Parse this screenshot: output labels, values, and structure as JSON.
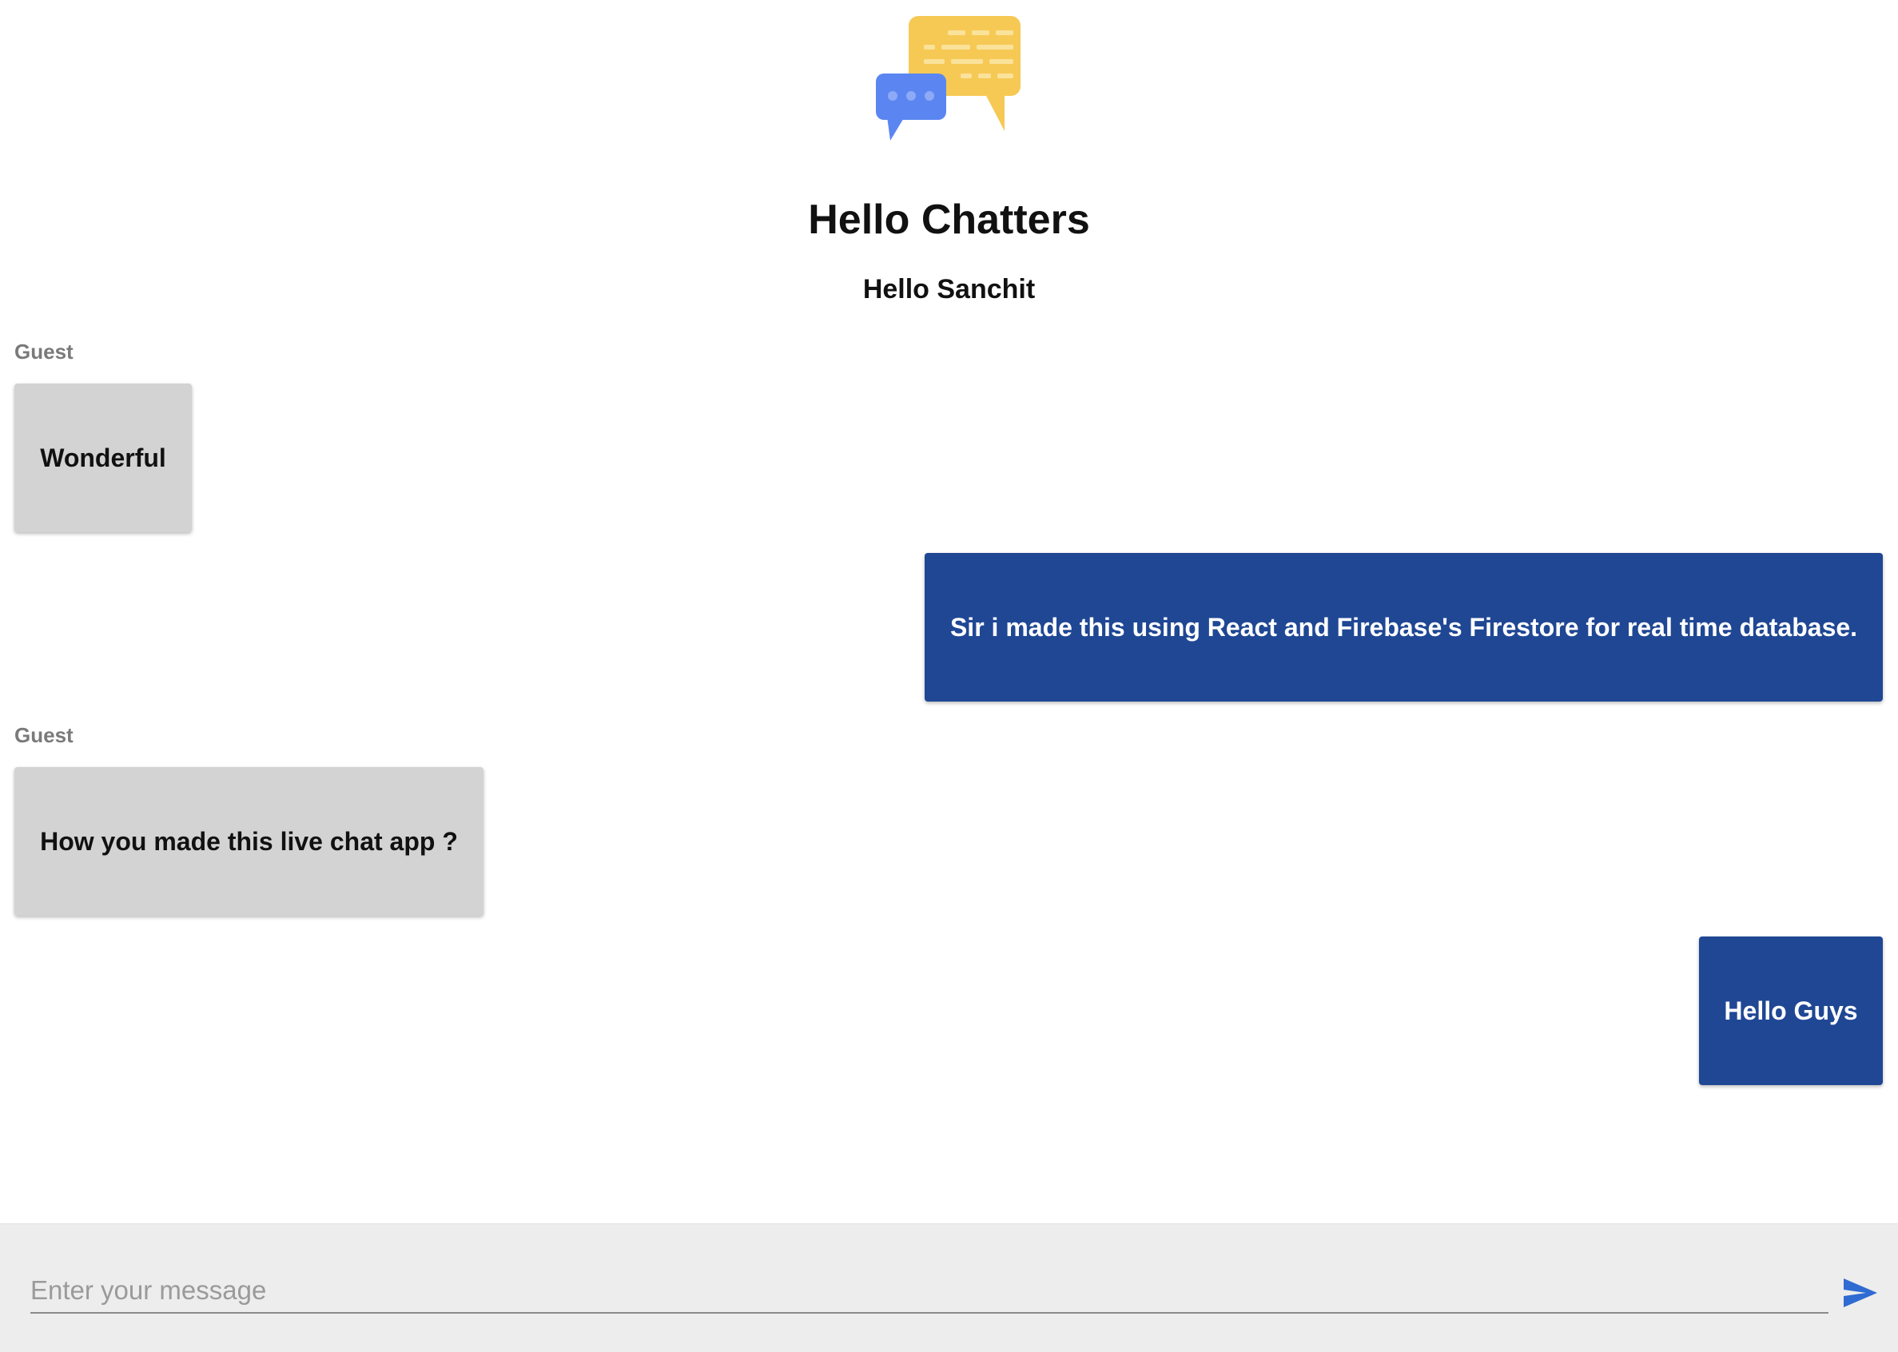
{
  "app": {
    "title": "Hello Chatters",
    "greeting": "Hello Sanchit",
    "logo_icon": "chat-bubbles-icon"
  },
  "colors": {
    "own_bubble": "#1f4794",
    "guest_bubble": "#d3d3d3",
    "logo_yellow": "#f6c955",
    "logo_blue": "#5b86f2",
    "send_icon": "#2f6bd1"
  },
  "messages": [
    {
      "sender": "Guest",
      "text": "Wonderful",
      "own": false
    },
    {
      "sender": "",
      "text": "Sir i made this using React and Firebase's Firestore for real time database.",
      "own": true
    },
    {
      "sender": "Guest",
      "text": "How you made this live chat app ?",
      "own": false
    },
    {
      "sender": "",
      "text": "Hello Guys",
      "own": true
    }
  ],
  "composer": {
    "placeholder": "Enter your message",
    "value": "",
    "send_icon": "send-icon"
  }
}
